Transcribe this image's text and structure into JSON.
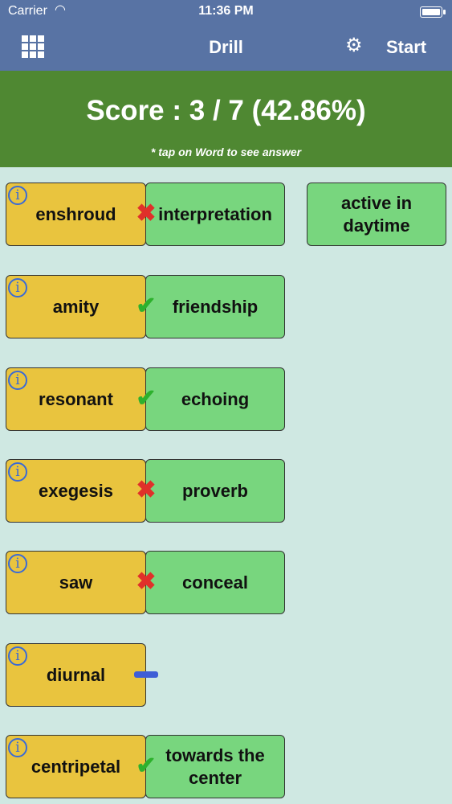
{
  "status": {
    "carrier": "Carrier",
    "time": "11:36 PM"
  },
  "nav": {
    "title": "Drill",
    "start_label": "Start",
    "grid_icon": "grid-icon",
    "settings_icon": "gear-icon"
  },
  "score": {
    "label": "Score  :  3 / 7 (42.86%)",
    "hint": "* tap on Word to see answer"
  },
  "extra_answer": "active in daytime",
  "rows": [
    {
      "word": "enshroud",
      "answer": "interpretation",
      "result": "wrong"
    },
    {
      "word": "amity",
      "answer": "friendship",
      "result": "right"
    },
    {
      "word": "resonant",
      "answer": "echoing",
      "result": "right"
    },
    {
      "word": "exegesis",
      "answer": "proverb",
      "result": "wrong"
    },
    {
      "word": "saw",
      "answer": "conceal",
      "result": "wrong"
    },
    {
      "word": "diurnal",
      "answer": "",
      "result": "pending"
    },
    {
      "word": "centripetal",
      "answer": "towards the center",
      "result": "right"
    }
  ],
  "colors": {
    "nav": "#5873a4",
    "score_panel": "#4f8832",
    "word_card": "#e9c43e",
    "answer_card": "#78d67e",
    "wrong": "#e0302a",
    "right": "#2db12d"
  }
}
